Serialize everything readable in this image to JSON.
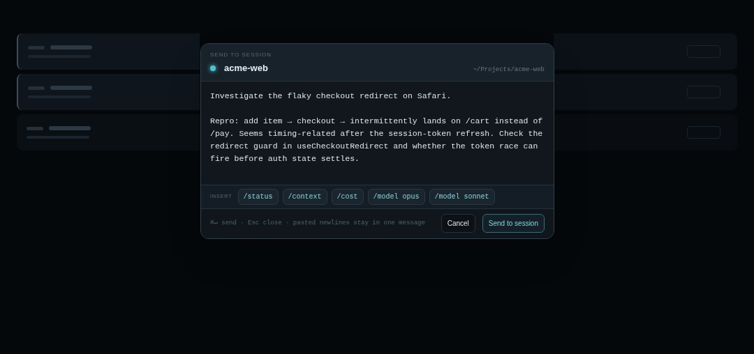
{
  "sessions": [
    {
      "selected": true
    },
    {
      "selected": true
    },
    {
      "selected": false
    }
  ],
  "dialog": {
    "eyebrow": "SEND TO SESSION",
    "session": "acme-web",
    "path": "~/Projects/acme-web",
    "message": "Investigate the flaky checkout redirect on Safari.\n\nRepro: add item → checkout → intermittently lands on /cart instead of /pay. Seems timing-related after the session-token refresh. Check the redirect guard in useCheckoutRedirect and whether the token race can fire before auth state settles.",
    "insert_label": "INSERT",
    "inserts": [
      "/status",
      "/context",
      "/cost",
      "/model opus",
      "/model sonnet"
    ],
    "hint": "⌘↵ send · Esc close · pasted newlines stay in one message",
    "cancel": "Cancel",
    "submit": "Send to session"
  }
}
